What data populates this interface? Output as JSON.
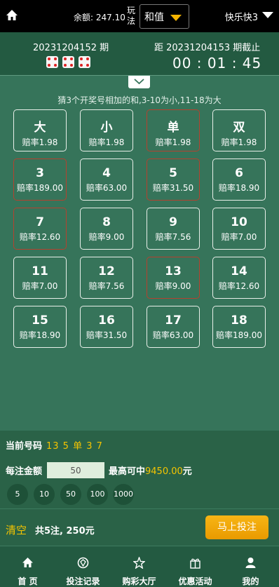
{
  "header": {
    "balance_label": "余额: 247.10",
    "play_label": "玩法",
    "play_value": "和值",
    "game_name": "快乐快3"
  },
  "period": {
    "current": "20231204152 期",
    "next": "距 20231204153 期截止",
    "countdown": "00 : 01 : 45"
  },
  "hint": "猜3个开奖号相加的和,3-10为小,11-18为大",
  "bets": [
    {
      "title": "大",
      "odds": "赔率1.98",
      "selected": false
    },
    {
      "title": "小",
      "odds": "赔率1.98",
      "selected": false
    },
    {
      "title": "单",
      "odds": "赔率1.98",
      "selected": true
    },
    {
      "title": "双",
      "odds": "赔率1.98",
      "selected": false
    },
    {
      "title": "3",
      "odds": "赔率189.00",
      "selected": true
    },
    {
      "title": "4",
      "odds": "赔率63.00",
      "selected": false
    },
    {
      "title": "5",
      "odds": "赔率31.50",
      "selected": true
    },
    {
      "title": "6",
      "odds": "赔率18.90",
      "selected": false
    },
    {
      "title": "7",
      "odds": "赔率12.60",
      "selected": true
    },
    {
      "title": "8",
      "odds": "赔率9.00",
      "selected": false
    },
    {
      "title": "9",
      "odds": "赔率7.56",
      "selected": false
    },
    {
      "title": "10",
      "odds": "赔率7.00",
      "selected": false
    },
    {
      "title": "11",
      "odds": "赔率7.00",
      "selected": false
    },
    {
      "title": "12",
      "odds": "赔率7.56",
      "selected": false
    },
    {
      "title": "13",
      "odds": "赔率9.00",
      "selected": true
    },
    {
      "title": "14",
      "odds": "赔率12.60",
      "selected": false
    },
    {
      "title": "15",
      "odds": "赔率18.90",
      "selected": false
    },
    {
      "title": "16",
      "odds": "赔率31.50",
      "selected": false
    },
    {
      "title": "17",
      "odds": "赔率63.00",
      "selected": false
    },
    {
      "title": "18",
      "odds": "赔率189.00",
      "selected": false
    }
  ],
  "current_numbers": {
    "label": "当前号码",
    "value": "13 5 单 3 7"
  },
  "amount": {
    "label": "每注金额",
    "value": "50",
    "max_label": "最高可中",
    "max_value": "9450.00",
    "max_unit": "元"
  },
  "chips": [
    "5",
    "10",
    "50",
    "100",
    "1000"
  ],
  "footer": {
    "clear": "清空",
    "summary": "共5注, 250元",
    "submit": "马上投注"
  },
  "nav": [
    {
      "label": "首 页",
      "icon": "home-icon"
    },
    {
      "label": "投注记录",
      "icon": "record-icon"
    },
    {
      "label": "购彩大厅",
      "icon": "lottery-hall-icon"
    },
    {
      "label": "优惠活动",
      "icon": "gift-icon"
    },
    {
      "label": "我的",
      "icon": "user-icon"
    }
  ],
  "colors": {
    "background": "#36745a",
    "accent": "#f5c400",
    "selected_border": "#b5412f"
  }
}
